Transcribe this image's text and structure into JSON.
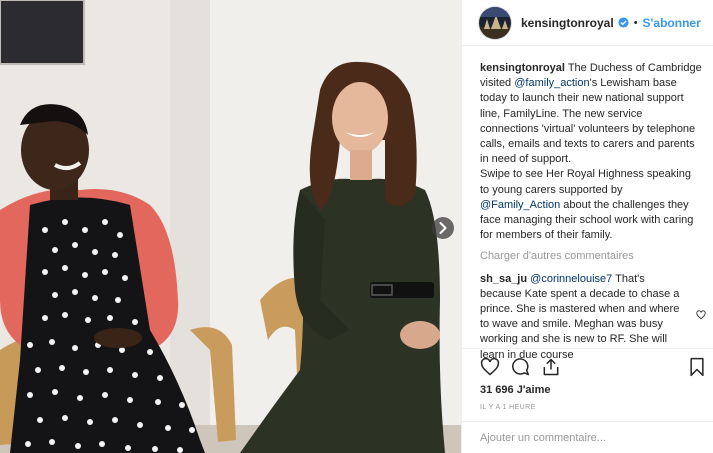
{
  "photo": {
    "alt": "Photo"
  },
  "header": {
    "username": "kensingtonroyal",
    "follow_label": "S'abonner",
    "separator": "•"
  },
  "caption": {
    "username": "kensingtonroyal",
    "text_1": " The Duchess of Cambridge visited ",
    "mention_1": "@family_action",
    "text_2": "'s Lewisham base today to launch their new national support line, FamilyLine. The new service connections 'virtual' volunteers by telephone calls, emails and texts to carers and parents in need of support.",
    "text_3": "Swipe to see Her Royal Highness speaking to young carers supported by ",
    "mention_2": "@Family_Action",
    "text_4": " about the challenges they face managing their school work with caring for members of their family."
  },
  "load_more": "Charger d'autres commentaires",
  "comment": {
    "username": "sh_sa_ju",
    "mention": "@corinnelouise7",
    "text": " That's because Kate spent a decade to chase a prince. She is mastered when and where to wave and smile. Meghan was busy working and she is new to RF. She will learn in due course"
  },
  "likes": "31 696 J'aime",
  "time": "IL Y A 1 HEURE",
  "add_comment_placeholder": "Ajouter un commentaire...",
  "colors": {
    "link": "#3897f0",
    "mention": "#003569",
    "muted": "#999999"
  },
  "icons": [
    "verified-badge-icon",
    "chevron-right-icon",
    "heart-icon",
    "comment-icon",
    "share-icon",
    "bookmark-icon"
  ]
}
